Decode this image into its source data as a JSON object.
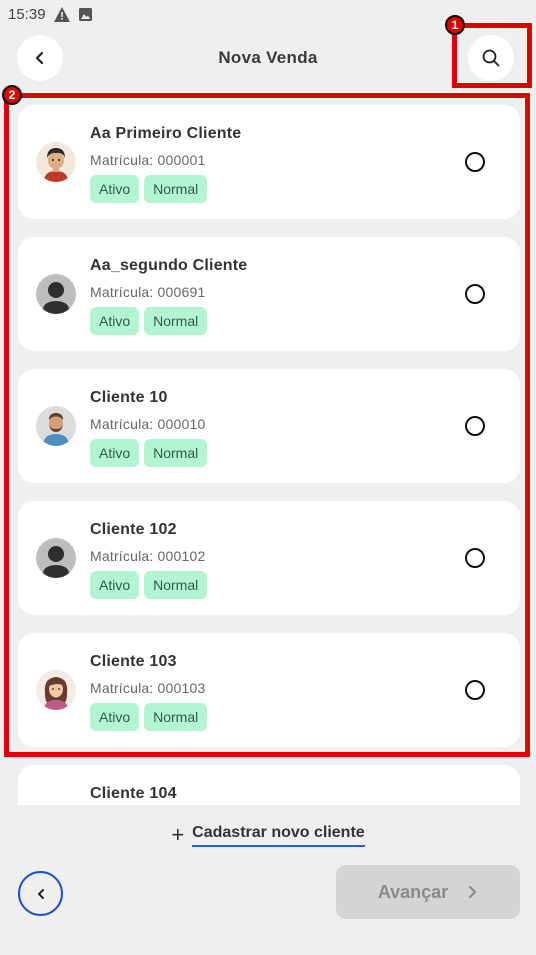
{
  "status_bar": {
    "time": "15:39",
    "icons": [
      "warning-icon",
      "image-notification-icon"
    ]
  },
  "header": {
    "title": "Nova Venda",
    "back_icon": "chevron-left-icon",
    "search_icon": "search-icon"
  },
  "annotations": [
    {
      "label": "1",
      "target": "search-button"
    },
    {
      "label": "2",
      "target": "client-list"
    }
  ],
  "colors": {
    "annotation_red": "#e00000",
    "tag_green": "#b3f5d2",
    "link_blue": "#2a5bd7"
  },
  "clients": [
    {
      "name": "Aa Primeiro Cliente",
      "matricula": "Matrícula: 000001",
      "status": "Ativo",
      "type": "Normal",
      "avatar": "male-cartoon-avatar"
    },
    {
      "name": "Aa_segundo Cliente",
      "matricula": "Matrícula: 000691",
      "status": "Ativo",
      "type": "Normal",
      "avatar": "default-person-avatar"
    },
    {
      "name": "Cliente 10",
      "matricula": "Matrícula: 000010",
      "status": "Ativo",
      "type": "Normal",
      "avatar": "bearded-man-avatar"
    },
    {
      "name": "Cliente 102",
      "matricula": "Matrícula: 000102",
      "status": "Ativo",
      "type": "Normal",
      "avatar": "default-person-avatar"
    },
    {
      "name": "Cliente 103",
      "matricula": "Matrícula: 000103",
      "status": "Ativo",
      "type": "Normal",
      "avatar": "female-cartoon-avatar"
    },
    {
      "name": "Cliente 104",
      "matricula": "",
      "status": "",
      "type": "",
      "avatar": ""
    }
  ],
  "footer": {
    "add_client_label": "Cadastrar novo cliente",
    "add_client_prefix": "+",
    "next_label": "Avançar",
    "back_icon": "chevron-left-icon",
    "next_icon": "chevron-right-icon"
  }
}
